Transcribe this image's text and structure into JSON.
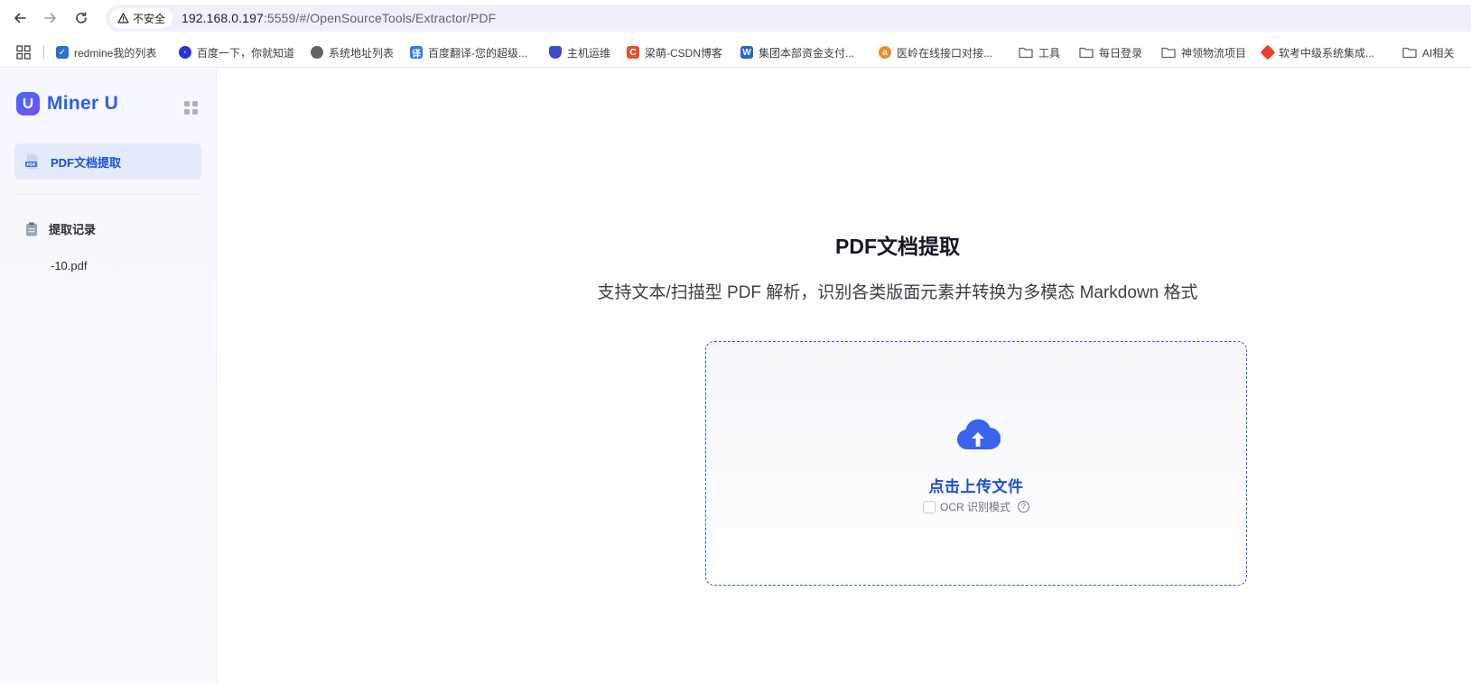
{
  "browser": {
    "security_label": "不安全",
    "url_host": "192.168.0.197",
    "url_path": ":5559/#/OpenSourceTools/Extractor/PDF",
    "bookmarks": [
      {
        "label": "redmine我的列表",
        "icon": "redmine-icon",
        "color": "#2b6fd6"
      },
      {
        "label": "百度一下，你就知道",
        "icon": "baidu-paw-icon",
        "color": "#2932e1"
      },
      {
        "label": "系统地址列表",
        "icon": "globe-icon",
        "color": "#5f6368"
      },
      {
        "label": "百度翻译-您的超级...",
        "icon": "translate-icon",
        "color": "#2b7bf0"
      },
      {
        "label": "主机运维",
        "icon": "shield-icon",
        "color": "#3b4cca"
      },
      {
        "label": "梁萌-CSDN博客",
        "icon": "csdn-icon",
        "color": "#e8502b"
      },
      {
        "label": "集团本部资金支付...",
        "icon": "app-icon",
        "color": "#2a63d6"
      },
      {
        "label": "医岭在线接口对接...",
        "icon": "orange-app-icon",
        "color": "#f08a24"
      },
      {
        "label": "工具",
        "icon": "folder-icon",
        "color": "#5f6368"
      },
      {
        "label": "每日登录",
        "icon": "folder-icon",
        "color": "#5f6368"
      },
      {
        "label": "神领物流项目",
        "icon": "folder-icon",
        "color": "#5f6368"
      },
      {
        "label": "软考中级系统集成...",
        "icon": "ruankao-icon",
        "color": "#e8402b"
      },
      {
        "label": "AI相关",
        "icon": "folder-icon",
        "color": "#5f6368"
      }
    ]
  },
  "app": {
    "brand": "Miner U",
    "brand_color": "#2f5bf0",
    "nav": {
      "active_label": "PDF文档提取"
    },
    "history": {
      "title": "提取记录",
      "items": [
        "-10.pdf"
      ]
    }
  },
  "main": {
    "title": "PDF文档提取",
    "subtitle": "支持文本/扫描型 PDF 解析，识别各类版面元素并转换为多模态 Markdown 格式",
    "upload": {
      "label": "点击上传文件",
      "ocr_label": "OCR 识别模式",
      "ocr_checked": false,
      "help_glyph": "?"
    },
    "accent_color": "#1d4ed8"
  }
}
